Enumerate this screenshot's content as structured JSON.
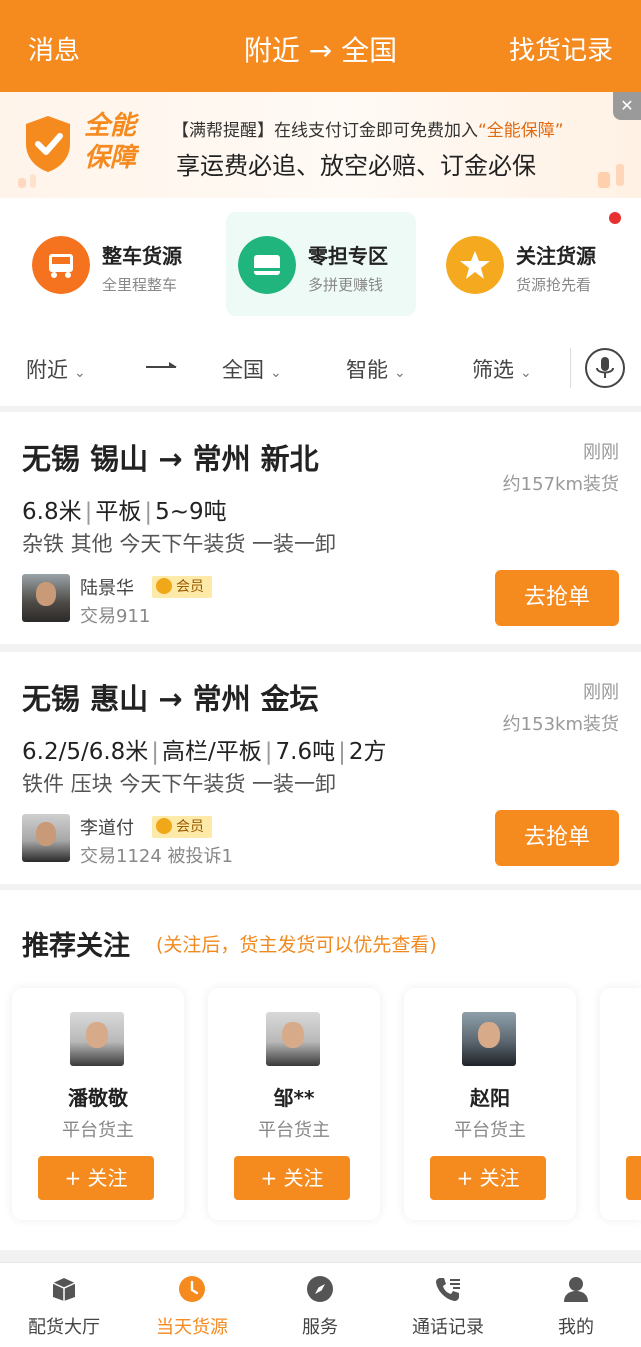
{
  "header": {
    "left": "消息",
    "center": "附近 → 全国",
    "right": "找货记录"
  },
  "banner": {
    "brand_line1": "全能",
    "brand_line2": "保障",
    "tip_prefix": "【满帮提醒】在线支付订金即可免费加入",
    "tip_highlight": "“全能保障”",
    "slogan": "享运费必追、放空必赔、订金必保",
    "close": "✕"
  },
  "quick": [
    {
      "title": "整车货源",
      "sub": "全里程整车",
      "color": "#f5731f"
    },
    {
      "title": "零担专区",
      "sub": "多拼更赚钱",
      "color": "#1fb57c"
    },
    {
      "title": "关注货源",
      "sub": "货源抢先看",
      "color": "#f5a91f"
    }
  ],
  "filters": {
    "origin": "附近",
    "dest": "全国",
    "sort": "智能",
    "filter": "筛选",
    "chev": "⌄"
  },
  "cargo": [
    {
      "route": "无锡 锡山 → 常州 新北",
      "time": "刚刚",
      "dist": "约157km装货",
      "spec1": "6.8米",
      "spec2": "平板",
      "spec3": "5~9吨",
      "spec4": "",
      "goods": "杂铁 其他 今天下午装货 一装一卸",
      "name": "陆景华",
      "vip": "会员",
      "trade": "交易911",
      "grab": "去抢单"
    },
    {
      "route": "无锡 惠山 → 常州 金坛",
      "time": "刚刚",
      "dist": "约153km装货",
      "spec1": "6.2/5/6.8米",
      "spec2": "高栏/平板",
      "spec3": "7.6吨",
      "spec4": "2方",
      "goods": "铁件 压块 今天下午装货 一装一卸",
      "name": "李道付",
      "vip": "会员",
      "trade": "交易1124 被投诉1",
      "grab": "去抢单"
    }
  ],
  "recommend": {
    "title": "推荐关注",
    "sub": "(关注后，货主发货可以优先查看)",
    "items": [
      {
        "name": "潘敬敬",
        "role": "平台货主",
        "follow": "+ 关注"
      },
      {
        "name": "邹**",
        "role": "平台货主",
        "follow": "+ 关注"
      },
      {
        "name": "赵阳",
        "role": "平台货主",
        "follow": "+ 关注"
      }
    ]
  },
  "tabs": [
    {
      "label": "配货大厅",
      "icon": "box-icon"
    },
    {
      "label": "当天货源",
      "icon": "clock-icon"
    },
    {
      "label": "服务",
      "icon": "compass-icon"
    },
    {
      "label": "通话记录",
      "icon": "phone-icon"
    },
    {
      "label": "我的",
      "icon": "user-icon"
    }
  ],
  "colors": {
    "accent": "#f58a1f"
  }
}
